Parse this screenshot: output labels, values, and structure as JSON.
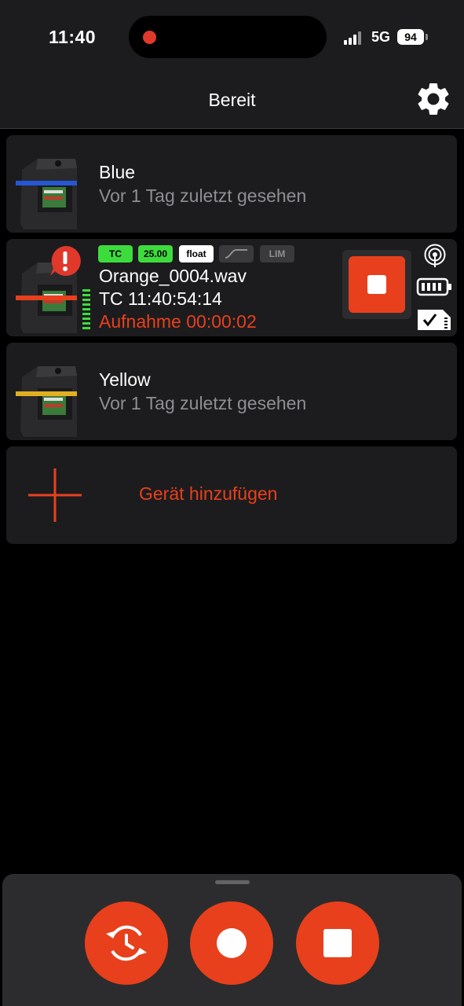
{
  "status_bar": {
    "time": "11:40",
    "network": "5G",
    "battery": "94"
  },
  "header": {
    "title": "Bereit"
  },
  "devices": [
    {
      "name": "Blue",
      "subtitle": "Vor 1 Tag zuletzt gesehen",
      "color": "#2457d6"
    },
    {
      "badges": [
        "TC",
        "25.00",
        "float",
        "",
        "LIM"
      ],
      "filename": "Orange_0004.wav",
      "timecode": "TC 11:40:54:14",
      "recording": "Aufnahme 00:00:02",
      "color": "#e8401c"
    },
    {
      "name": "Yellow",
      "subtitle": "Vor 1 Tag zuletzt gesehen",
      "color": "#e0b020"
    }
  ],
  "add_device": {
    "label": "Gerät hinzufügen"
  },
  "colors": {
    "accent": "#e8401c",
    "card": "#1c1c1e",
    "badge_green": "#3ddc3d"
  }
}
